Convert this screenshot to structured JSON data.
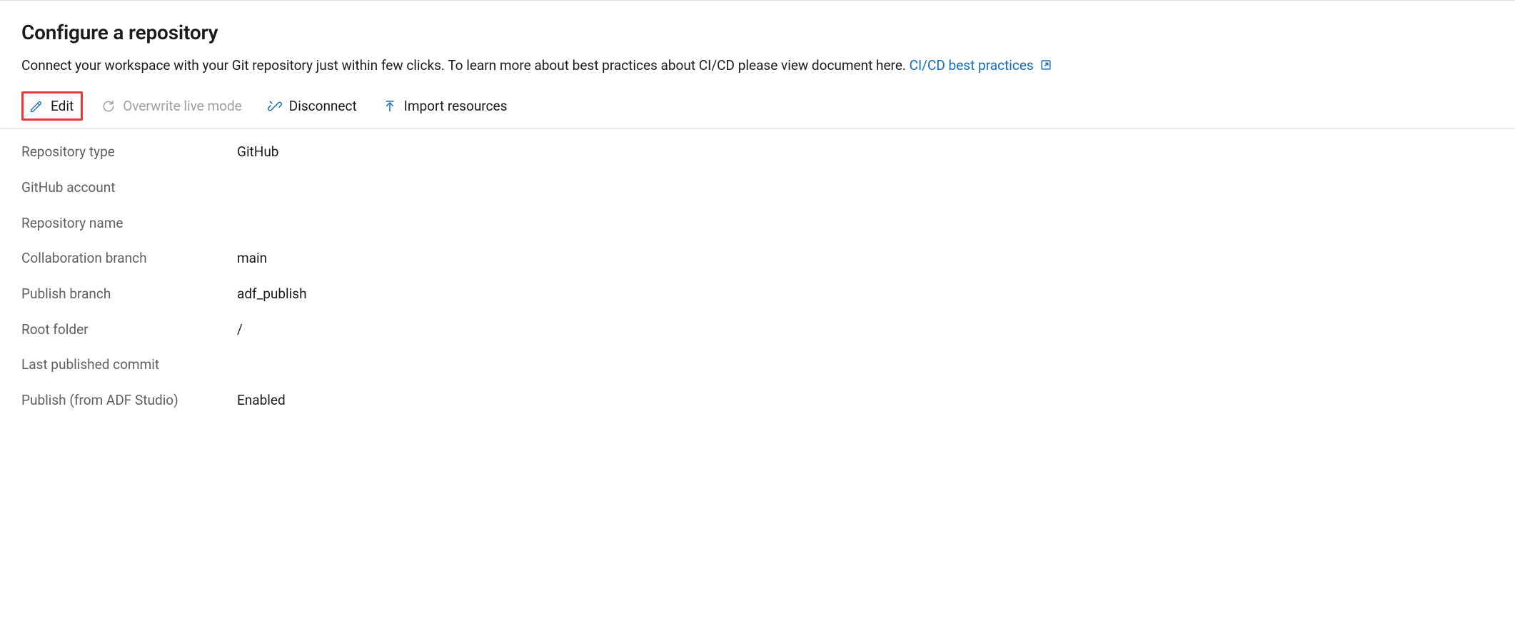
{
  "header": {
    "title": "Configure a repository",
    "subtitle": "Connect your workspace with your Git repository just within few clicks. To learn more about best practices about CI/CD please view document here.",
    "link_label": "CI/CD best practices"
  },
  "toolbar": {
    "edit": "Edit",
    "overwrite": "Overwrite live mode",
    "disconnect": "Disconnect",
    "import": "Import resources"
  },
  "details": {
    "rows": [
      {
        "label": "Repository type",
        "value": "GitHub"
      },
      {
        "label": "GitHub account",
        "value": ""
      },
      {
        "label": "Repository name",
        "value": ""
      },
      {
        "label": "Collaboration branch",
        "value": "main"
      },
      {
        "label": "Publish branch",
        "value": "adf_publish"
      },
      {
        "label": "Root folder",
        "value": "/"
      },
      {
        "label": "Last published commit",
        "value": ""
      },
      {
        "label": "Publish (from ADF Studio)",
        "value": "Enabled"
      }
    ]
  }
}
